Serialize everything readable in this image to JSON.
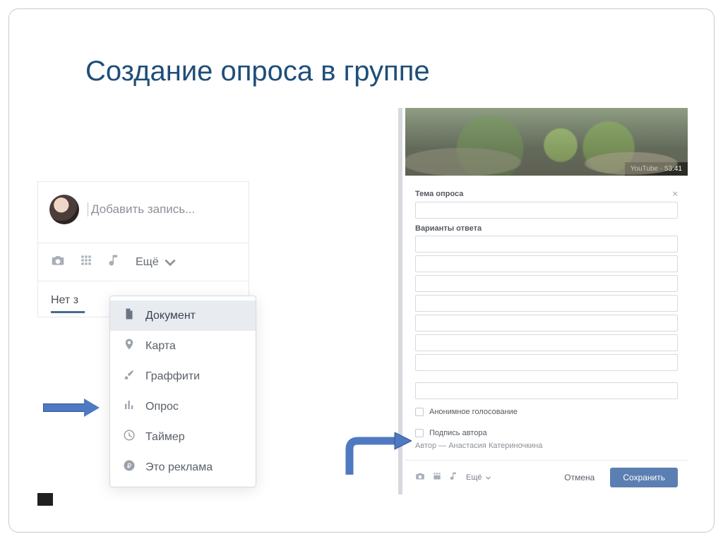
{
  "slide": {
    "title": "Создание опроса в группе"
  },
  "composer": {
    "placeholder": "Добавить запись...",
    "more_label": "Ещё",
    "tab_cut": "Нет з"
  },
  "menu": {
    "items": [
      {
        "key": "document",
        "label": "Документ",
        "icon": "file-icon"
      },
      {
        "key": "map",
        "label": "Карта",
        "icon": "pin-icon"
      },
      {
        "key": "graffiti",
        "label": "Граффити",
        "icon": "brush-icon"
      },
      {
        "key": "poll",
        "label": "Опрос",
        "icon": "bars-icon"
      },
      {
        "key": "timer",
        "label": "Таймер",
        "icon": "clock-icon"
      },
      {
        "key": "ad",
        "label": "Это реклама",
        "icon": "ruble-icon"
      }
    ]
  },
  "poll": {
    "video_source": "YouTube",
    "video_duration": "53:41",
    "topic_label": "Тема опроса",
    "answers_label": "Варианты ответа",
    "anonymous_label": "Анонимное голосование",
    "signature_label": "Подпись автора",
    "author_prefix": "Автор —",
    "author_name": "Анастасия Катериночкина",
    "footer_more": "Ещё",
    "cancel": "Отмена",
    "save": "Сохранить",
    "answer_slots": 8
  }
}
